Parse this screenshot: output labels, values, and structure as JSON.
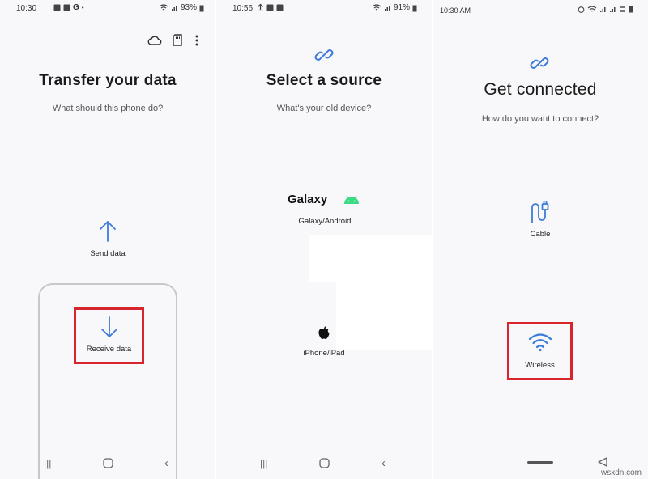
{
  "panels": [
    {
      "status": {
        "time": "10:30",
        "battery": "93%"
      },
      "title": "Transfer your data",
      "subtitle": "What should this phone do?",
      "options": [
        {
          "label": "Send data"
        },
        {
          "label": "Receive data",
          "selected": true
        }
      ]
    },
    {
      "status": {
        "time": "10:56",
        "battery": "91%"
      },
      "title": "Select a source",
      "subtitle": "What's your old device?",
      "options": [
        {
          "brand": "Galaxy",
          "label": "Galaxy/Android"
        },
        {
          "label": "iPhone/iPad"
        }
      ]
    },
    {
      "status": {
        "time": "10:30 AM"
      },
      "title": "Get connected",
      "subtitle": "How do you want to connect?",
      "options": [
        {
          "label": "Cable"
        },
        {
          "label": "Wireless",
          "selected": true
        }
      ]
    }
  ],
  "watermark": "wsxdn.com",
  "colors": {
    "accent_blue": "#3d7bd9",
    "highlight_red": "#d6262c",
    "android_green": "#3ddc84"
  }
}
